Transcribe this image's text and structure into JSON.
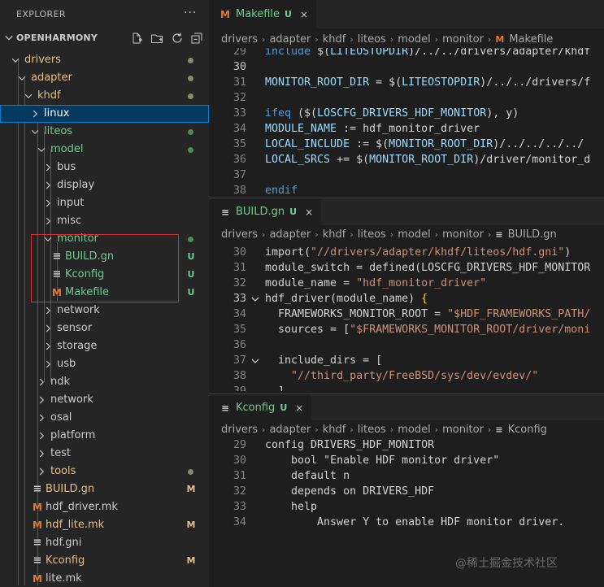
{
  "colors": {
    "git_untracked": "#73c991",
    "git_modified": "#e2c08d",
    "folder_modified_dot": "#8c8c64",
    "folder_untracked_dot": "#4f8a55",
    "makefile_icon": "#e37933",
    "file_icon": "#cccccc",
    "selection": "#04395e",
    "highlight_box": "#d4312f"
  },
  "sidebar": {
    "title": "EXPLORER",
    "more_actions": "···",
    "root_name": "OPENHARMONY",
    "root_actions": [
      "new-file-icon",
      "new-folder-icon",
      "refresh-icon",
      "collapse-all-icon"
    ],
    "items": [
      {
        "label": "drivers",
        "kind": "folder",
        "open": true,
        "status": "dot-modified"
      },
      {
        "label": "adapter",
        "kind": "folder",
        "open": true,
        "status": "dot-modified"
      },
      {
        "label": "khdf",
        "kind": "folder",
        "open": true,
        "status": "dot-modified"
      },
      {
        "label": "linux",
        "kind": "folder",
        "open": false,
        "status": "",
        "selected": true
      },
      {
        "label": "liteos",
        "kind": "folder",
        "open": true,
        "status": "dot-untracked"
      },
      {
        "label": "model",
        "kind": "folder",
        "open": true,
        "status": "dot-untracked"
      },
      {
        "label": "bus",
        "kind": "folder",
        "open": false,
        "status": ""
      },
      {
        "label": "display",
        "kind": "folder",
        "open": false,
        "status": ""
      },
      {
        "label": "input",
        "kind": "folder",
        "open": false,
        "status": ""
      },
      {
        "label": "misc",
        "kind": "folder",
        "open": false,
        "status": ""
      },
      {
        "label": "monitor",
        "kind": "folder",
        "open": true,
        "status": "dot-untracked"
      },
      {
        "label": "BUILD.gn",
        "kind": "file",
        "icon": "lines-icon",
        "status": "U"
      },
      {
        "label": "Kconfig",
        "kind": "file",
        "icon": "lines-icon",
        "status": "U"
      },
      {
        "label": "Makefile",
        "kind": "file",
        "icon": "makefile-icon",
        "status": "U"
      },
      {
        "label": "network",
        "kind": "folder",
        "open": false,
        "status": ""
      },
      {
        "label": "sensor",
        "kind": "folder",
        "open": false,
        "status": ""
      },
      {
        "label": "storage",
        "kind": "folder",
        "open": false,
        "status": ""
      },
      {
        "label": "usb",
        "kind": "folder",
        "open": false,
        "status": ""
      },
      {
        "label": "ndk",
        "kind": "folder",
        "open": false,
        "status": ""
      },
      {
        "label": "network",
        "kind": "folder",
        "open": false,
        "status": ""
      },
      {
        "label": "osal",
        "kind": "folder",
        "open": false,
        "status": ""
      },
      {
        "label": "platform",
        "kind": "folder",
        "open": false,
        "status": ""
      },
      {
        "label": "test",
        "kind": "folder",
        "open": false,
        "status": ""
      },
      {
        "label": "tools",
        "kind": "folder",
        "open": false,
        "status": "dot-modified"
      },
      {
        "label": "BUILD.gn",
        "kind": "file",
        "icon": "lines-icon",
        "status": "M"
      },
      {
        "label": "hdf_driver.mk",
        "kind": "file",
        "icon": "makefile-icon",
        "status": ""
      },
      {
        "label": "hdf_lite.mk",
        "kind": "file",
        "icon": "makefile-icon",
        "status": "M"
      },
      {
        "label": "hdf.gni",
        "kind": "file",
        "icon": "lines-icon",
        "status": ""
      },
      {
        "label": "Kconfig",
        "kind": "file",
        "icon": "lines-icon",
        "status": "M"
      },
      {
        "label": "lite.mk",
        "kind": "file",
        "icon": "makefile-icon",
        "status": ""
      }
    ]
  },
  "editors": [
    {
      "tab": {
        "label": "Makefile",
        "status": "U",
        "icon": "makefile-icon",
        "close": "×"
      },
      "breadcrumbs": [
        "drivers",
        "adapter",
        "khdf",
        "liteos",
        "model",
        "monitor"
      ],
      "breadcrumb_file": "Makefile",
      "lines": [
        {
          "n": "29",
          "tokens": [
            [
              "kw",
              "include"
            ],
            [
              "plain",
              " "
            ],
            [
              "plain",
              "$("
            ],
            [
              "var",
              "LITEOSTOPDIR"
            ],
            [
              "plain",
              ")/../../drivers/adapter/khdf"
            ]
          ]
        },
        {
          "n": "30",
          "active": true,
          "tokens": []
        },
        {
          "n": "31",
          "tokens": [
            [
              "var",
              "MONITOR_ROOT_DIR"
            ],
            [
              "plain",
              " = "
            ],
            [
              "plain",
              "$("
            ],
            [
              "var",
              "LITEOSTOPDIR"
            ],
            [
              "plain",
              ")/../../drivers/f"
            ]
          ]
        },
        {
          "n": "32",
          "tokens": []
        },
        {
          "n": "33",
          "tokens": [
            [
              "kw",
              "ifeq"
            ],
            [
              "plain",
              " ($("
            ],
            [
              "var",
              "LOSCFG_DRIVERS_HDF_MONITOR"
            ],
            [
              "plain",
              "), y)"
            ]
          ]
        },
        {
          "n": "34",
          "tokens": [
            [
              "var",
              "MODULE_NAME"
            ],
            [
              "plain",
              " := hdf_monitor_driver"
            ]
          ]
        },
        {
          "n": "35",
          "tokens": [
            [
              "var",
              "LOCAL_INCLUDE"
            ],
            [
              "plain",
              " := $("
            ],
            [
              "var",
              "MONITOR_ROOT_DIR"
            ],
            [
              "plain",
              ")/../../../../"
            ]
          ]
        },
        {
          "n": "36",
          "tokens": [
            [
              "var",
              "LOCAL_SRCS"
            ],
            [
              "plain",
              " += $("
            ],
            [
              "var",
              "MONITOR_ROOT_DIR"
            ],
            [
              "plain",
              ")/driver/monitor_d"
            ]
          ]
        },
        {
          "n": "37",
          "tokens": []
        },
        {
          "n": "38",
          "tokens": [
            [
              "kw",
              "endif"
            ]
          ]
        }
      ]
    },
    {
      "tab": {
        "label": "BUILD.gn",
        "status": "U",
        "icon": "lines-icon",
        "close": "×"
      },
      "breadcrumbs": [
        "drivers",
        "adapter",
        "khdf",
        "liteos",
        "model",
        "monitor"
      ],
      "breadcrumb_file": "BUILD.gn",
      "lines": [
        {
          "n": "30",
          "tokens": [
            [
              "plain",
              "import("
            ],
            [
              "str",
              "\"//drivers/adapter/khdf/liteos/hdf.gni\""
            ],
            [
              "plain",
              ")"
            ]
          ]
        },
        {
          "n": "31",
          "tokens": [
            [
              "plain",
              "module_switch = defined(LOSCFG_DRIVERS_HDF_MONITOR"
            ]
          ]
        },
        {
          "n": "32",
          "tokens": [
            [
              "plain",
              "module_name = "
            ],
            [
              "str",
              "\"hdf_monitor_driver\""
            ]
          ]
        },
        {
          "n": "33",
          "active": true,
          "fold": true,
          "tokens": [
            [
              "plain",
              "hdf_driver(module_name) "
            ],
            [
              "bracket",
              "{"
            ]
          ]
        },
        {
          "n": "34",
          "tokens": [
            [
              "plain",
              "  FRAMEWORKS_MONITOR_ROOT = "
            ],
            [
              "str",
              "\"$HDF_FRAMEWORKS_PATH/"
            ]
          ]
        },
        {
          "n": "35",
          "tokens": [
            [
              "plain",
              "  sources = ["
            ],
            [
              "str",
              "\"$FRAMEWORKS_MONITOR_ROOT/driver/moni"
            ]
          ]
        },
        {
          "n": "36",
          "tokens": []
        },
        {
          "n": "37",
          "fold": true,
          "tokens": [
            [
              "plain",
              "  include_dirs = ["
            ]
          ]
        },
        {
          "n": "38",
          "tokens": [
            [
              "plain",
              "    "
            ],
            [
              "str",
              "\"//third_party/FreeBSD/sys/dev/evdev/\""
            ]
          ]
        },
        {
          "n": "39",
          "tokens": [
            [
              "plain",
              "  ]"
            ]
          ]
        }
      ]
    },
    {
      "tab": {
        "label": "Kconfig",
        "status": "U",
        "icon": "lines-icon",
        "close": "×"
      },
      "breadcrumbs": [
        "drivers",
        "adapter",
        "khdf",
        "liteos",
        "model",
        "monitor"
      ],
      "breadcrumb_file": "Kconfig",
      "lines": [
        {
          "n": "29",
          "tokens": [
            [
              "plain",
              "config DRIVERS_HDF_MONITOR"
            ]
          ]
        },
        {
          "n": "30",
          "tokens": [
            [
              "plain",
              "    bool "
            ],
            [
              "plain",
              "\"Enable HDF monitor driver\""
            ]
          ]
        },
        {
          "n": "31",
          "tokens": [
            [
              "plain",
              "    default n"
            ]
          ]
        },
        {
          "n": "32",
          "tokens": [
            [
              "plain",
              "    depends on DRIVERS_HDF"
            ]
          ]
        },
        {
          "n": "33",
          "tokens": [
            [
              "plain",
              "    help"
            ]
          ]
        },
        {
          "n": "34",
          "tokens": [
            [
              "plain",
              "        Answer Y to enable HDF monitor driver."
            ]
          ]
        }
      ]
    }
  ],
  "watermark": "@稀土掘金技术社区"
}
